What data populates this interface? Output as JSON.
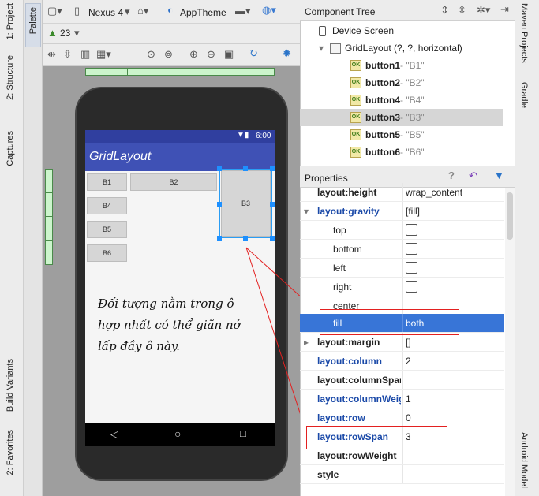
{
  "left_strip": {
    "tabs_top": [
      "1: Project",
      "2: Structure",
      "Captures"
    ],
    "tabs_bottom": [
      "Build Variants",
      "2: Favorites"
    ]
  },
  "palette": {
    "label": "Palette"
  },
  "toolbar": {
    "device": "Nexus 4",
    "theme": "AppTheme",
    "api_level": "23"
  },
  "app": {
    "status_time": "6:00",
    "title": "GridLayout",
    "buttons": [
      "B1",
      "B2",
      "B4",
      "B3",
      "B5",
      "B6"
    ]
  },
  "annotation": {
    "text": "Đối tượng nằm trong ô\nhợp nhất có thể giãn nở\nlấp đầy ô này."
  },
  "component_tree": {
    "title": "Component Tree",
    "root": "Device Screen",
    "layout": "GridLayout (?, ?, horizontal)",
    "items": [
      {
        "id": "button1",
        "text": " - \"B1\""
      },
      {
        "id": "button2",
        "text": " - \"B2\""
      },
      {
        "id": "button4",
        "text": " - \"B4\""
      },
      {
        "id": "button3",
        "text": " - \"B3\""
      },
      {
        "id": "button5",
        "text": " - \"B5\""
      },
      {
        "id": "button6",
        "text": " - \"B6\""
      }
    ]
  },
  "properties": {
    "title": "Properties",
    "rows": [
      {
        "name": "layout:height",
        "value": "wrap_content"
      },
      {
        "name": "layout:gravity",
        "value": "[fill]"
      },
      {
        "name": "top",
        "value": ""
      },
      {
        "name": "bottom",
        "value": ""
      },
      {
        "name": "left",
        "value": ""
      },
      {
        "name": "right",
        "value": ""
      },
      {
        "name": "center",
        "value": ""
      },
      {
        "name": "fill",
        "value": "both"
      },
      {
        "name": "layout:margin",
        "value": "[]"
      },
      {
        "name": "layout:column",
        "value": "2"
      },
      {
        "name": "layout:columnSpan",
        "value": ""
      },
      {
        "name": "layout:columnWeig",
        "value": "1"
      },
      {
        "name": "layout:row",
        "value": "0"
      },
      {
        "name": "layout:rowSpan",
        "value": "3"
      },
      {
        "name": "layout:rowWeight",
        "value": ""
      },
      {
        "name": "style",
        "value": ""
      }
    ]
  },
  "right_strip": {
    "tabs": [
      "Maven Projects",
      "Gradle",
      "Android Model"
    ]
  },
  "colors": {
    "app_bar": "#3f51b5",
    "status_bar": "#303f9f",
    "selection": "#3875d7",
    "highlight_box": "#e32020"
  }
}
